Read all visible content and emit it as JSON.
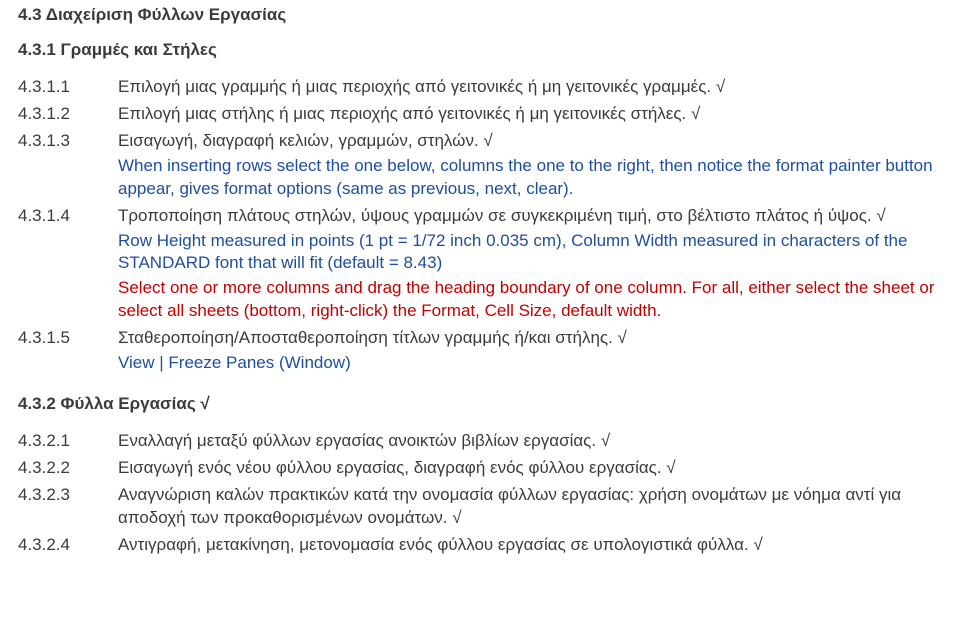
{
  "section": {
    "heading": "4.3 Διαχείριση Φύλλων Εργασίας",
    "subheading": "4.3.1 Γραμμές και Στήλες"
  },
  "items1": {
    "n4311": "4.3.1.1",
    "t4311": "Επιλογή μιας γραμμής ή μιας περιοχής από γειτονικές ή μη γειτονικές γραμμές. √",
    "n4312": "4.3.1.2",
    "t4312": "Επιλογή μιας στήλης ή μιας περιοχής από γειτονικές ή μη γειτονικές στήλες. √",
    "n4313": "4.3.1.3",
    "t4313a": "Εισαγωγή, διαγραφή κελιών, γραμμών, στηλών. √",
    "t4313b": "When inserting rows select the one below, columns the one to the right, then notice the format painter button appear, gives format options (same as previous, next, clear).",
    "n4314": "4.3.1.4",
    "t4314a": "Τροποποίηση πλάτους στηλών, ύψους γραμμών σε συγκεκριμένη τιμή, στο βέλτιστο πλάτος ή ύψος. √",
    "t4314b": "Row Height measured in points (1 pt = 1/72 inch 0.035 cm), Column Width measured in characters of the STANDARD font that will fit (default = 8.43)",
    "t4314c": "Select one or more columns and drag the heading boundary of one column. For all, either select the sheet or select all sheets (bottom, right-click) the Format, Cell Size, default width.",
    "n4315": "4.3.1.5",
    "t4315a": "Σταθεροποίηση/Αποσταθεροποίηση τίτλων γραμμής ή/και στήλης. √",
    "t4315b": "View | Freeze Panes (Window)"
  },
  "section2": {
    "heading": "4.3.2 Φύλλα Εργασίας √"
  },
  "items2": {
    "n4321": "4.3.2.1",
    "t4321": "Εναλλαγή μεταξύ φύλλων εργασίας ανοικτών βιβλίων εργασίας. √",
    "n4322": "4.3.2.2",
    "t4322": "Εισαγωγή ενός νέου φύλλου εργασίας, διαγραφή ενός φύλλου εργασίας. √",
    "n4323": "4.3.2.3",
    "t4323": "Αναγνώριση καλών πρακτικών κατά την ονομασία φύλλων εργασίας: χρήση ονομάτων με νόημα αντί για αποδοχή των προκαθορισμένων ονομάτων. √",
    "n4324": "4.3.2.4",
    "t4324": "Αντιγραφή, μετακίνηση, μετονομασία ενός φύλλου εργασίας σε υπολογιστικά φύλλα. √"
  }
}
